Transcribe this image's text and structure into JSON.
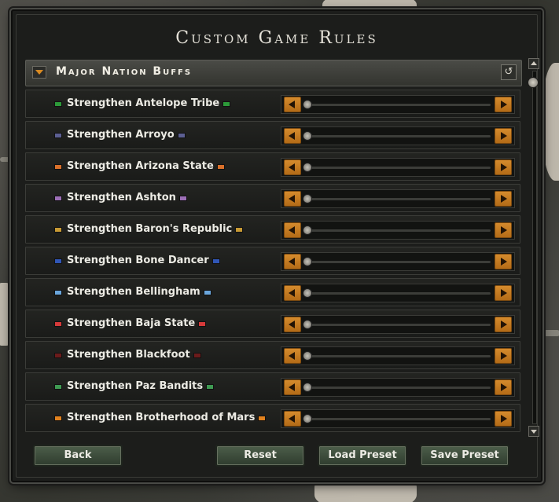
{
  "window": {
    "title": "Custom Game Rules"
  },
  "section": {
    "title": "Major Nation Buffs"
  },
  "rules": [
    {
      "label": "Strengthen Antelope Tribe",
      "flag_color": "#2c9a39",
      "value": 0
    },
    {
      "label": "Strengthen Arroyo",
      "flag_color": "#5c5f92",
      "value": 0
    },
    {
      "label": "Strengthen Arizona State",
      "flag_color": "#d9702a",
      "value": 0
    },
    {
      "label": "Strengthen Ashton",
      "flag_color": "#9c6fb6",
      "value": 0
    },
    {
      "label": "Strengthen Baron's Republic",
      "flag_color": "#c89a34",
      "value": 0
    },
    {
      "label": "Strengthen Bone Dancer",
      "flag_color": "#3056b6",
      "value": 0
    },
    {
      "label": "Strengthen Bellingham",
      "flag_color": "#6aa6dc",
      "value": 0
    },
    {
      "label": "Strengthen Baja State",
      "flag_color": "#d53a3a",
      "value": 0
    },
    {
      "label": "Strengthen Blackfoot",
      "flag_color": "#6b1b1b",
      "value": 0
    },
    {
      "label": "Strengthen Paz Bandits",
      "flag_color": "#3f9a52",
      "value": 0
    },
    {
      "label": "Strengthen Brotherhood of Mars",
      "flag_color": "#e1821e",
      "value": 0
    }
  ],
  "footer": {
    "back_label": "Back",
    "reset_label": "Reset",
    "load_label": "Load Preset",
    "save_label": "Save Preset"
  },
  "colors": {
    "accent": "#d58b2d",
    "button": "#3f4f3d"
  },
  "icons": {
    "collapse": "chevron-down-icon",
    "reset": "reset-icon",
    "slider_left": "arrow-left-icon",
    "slider_right": "arrow-right-icon"
  }
}
